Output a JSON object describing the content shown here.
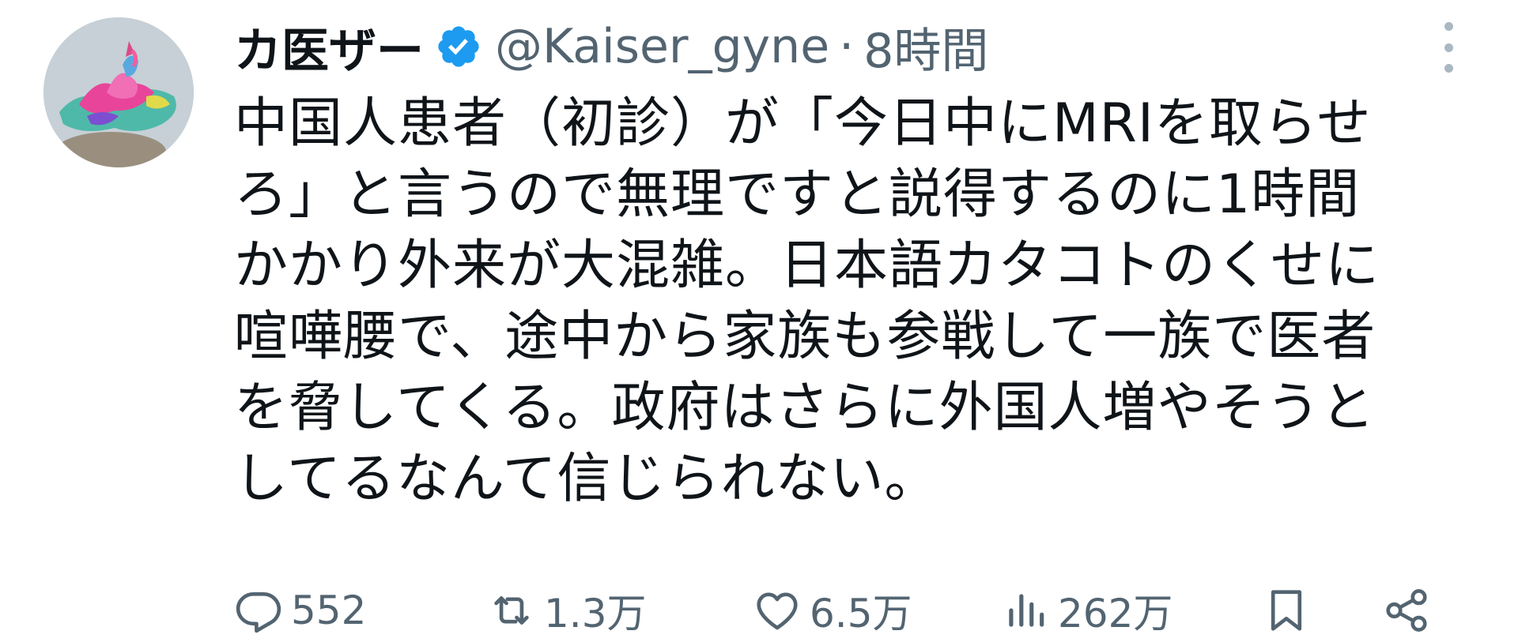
{
  "author": {
    "display_name": "カ医ザー",
    "handle": "@Kaiser_gyne",
    "separator": "·",
    "time": "8時間",
    "verified": true,
    "avatar_icon": "avatar-image",
    "verified_icon": "verified-badge-icon",
    "verified_color": "#1d9bf0"
  },
  "tweet": {
    "lines": [
      "中国人患者（初診）が「今日中にMRIを取らせ",
      "ろ」と言うので無理ですと説得するのに1時間",
      "かかり外来が大混雑。日本語カタコトのくせに",
      "喧嘩腰で、途中から家族も参戦して一族で医者",
      "を脅してくる。政府はさらに外国人増やそうと",
      "してるなんて信じられない。"
    ]
  },
  "actions": {
    "reply": {
      "icon": "reply-icon",
      "count": "552"
    },
    "retweet": {
      "icon": "retweet-icon",
      "count": "1.3万"
    },
    "like": {
      "icon": "heart-icon",
      "count": "6.5万"
    },
    "views": {
      "icon": "views-chart-icon",
      "count": "262万"
    },
    "bookmark": {
      "icon": "bookmark-icon"
    },
    "share": {
      "icon": "share-icon"
    }
  },
  "colors": {
    "text": "#0f1419",
    "secondary": "#536471",
    "accent": "#1d9bf0",
    "background": "#ffffff"
  }
}
